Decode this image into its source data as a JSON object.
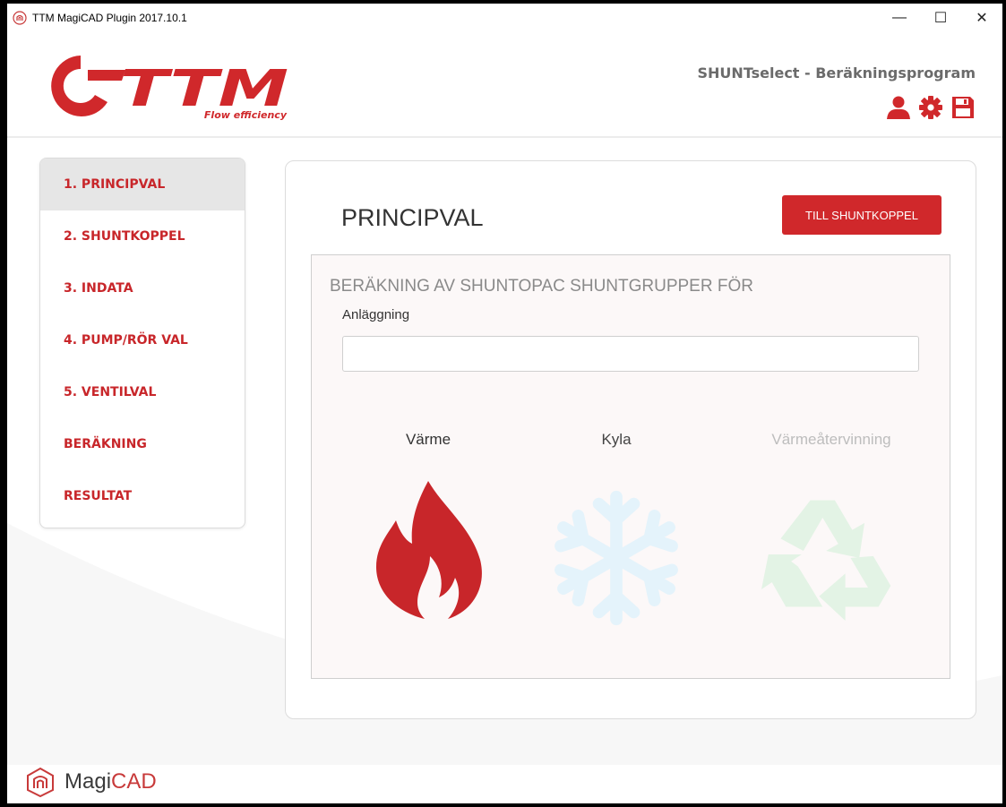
{
  "window": {
    "title": "TTM MagiCAD Plugin 2017.10.1",
    "controls": {
      "minimize": "—",
      "maximize": "☐",
      "close": "✕"
    }
  },
  "header": {
    "logo_text": "TTM",
    "logo_tagline": "Flow efficiency",
    "app_heading": "SHUNTselect - Beräkningsprogram",
    "icons": [
      "user-icon",
      "gear-icon",
      "save-icon"
    ]
  },
  "sidebar": {
    "items": [
      {
        "label": "1. PRINCIPVAL",
        "active": true
      },
      {
        "label": "2. SHUNTKOPPEL",
        "active": false
      },
      {
        "label": "3. INDATA",
        "active": false
      },
      {
        "label": "4. PUMP/RÖR VAL",
        "active": false
      },
      {
        "label": "5. VENTILVAL",
        "active": false
      },
      {
        "label": "BERÄKNING",
        "active": false
      },
      {
        "label": "RESULTAT",
        "active": false
      }
    ]
  },
  "main": {
    "title": "PRINCIPVAL",
    "next_button": "TILL SHUNTKOPPEL",
    "section_heading": "BERÄKNING AV SHUNTOPAC SHUNTGRUPPER FÖR",
    "facility_label": "Anläggning",
    "facility_value": "",
    "facility_placeholder": "",
    "options": [
      {
        "label": "Värme",
        "icon": "flame-icon",
        "state": "selected",
        "color": "#c8262a"
      },
      {
        "label": "Kyla",
        "icon": "snowflake-icon",
        "state": "unselected",
        "color": "#e6f4fb"
      },
      {
        "label": "Värmeåtervinning",
        "icon": "recycle-icon",
        "state": "disabled",
        "color": "#e4f4e6"
      }
    ]
  },
  "footer": {
    "brand_part1": "Magi",
    "brand_part2": "CAD"
  },
  "colors": {
    "accent": "#d0282b",
    "nav_text": "#c8262a",
    "active_nav_bg": "#e6e6e6",
    "subpanel_bg": "#fcf8f8"
  }
}
